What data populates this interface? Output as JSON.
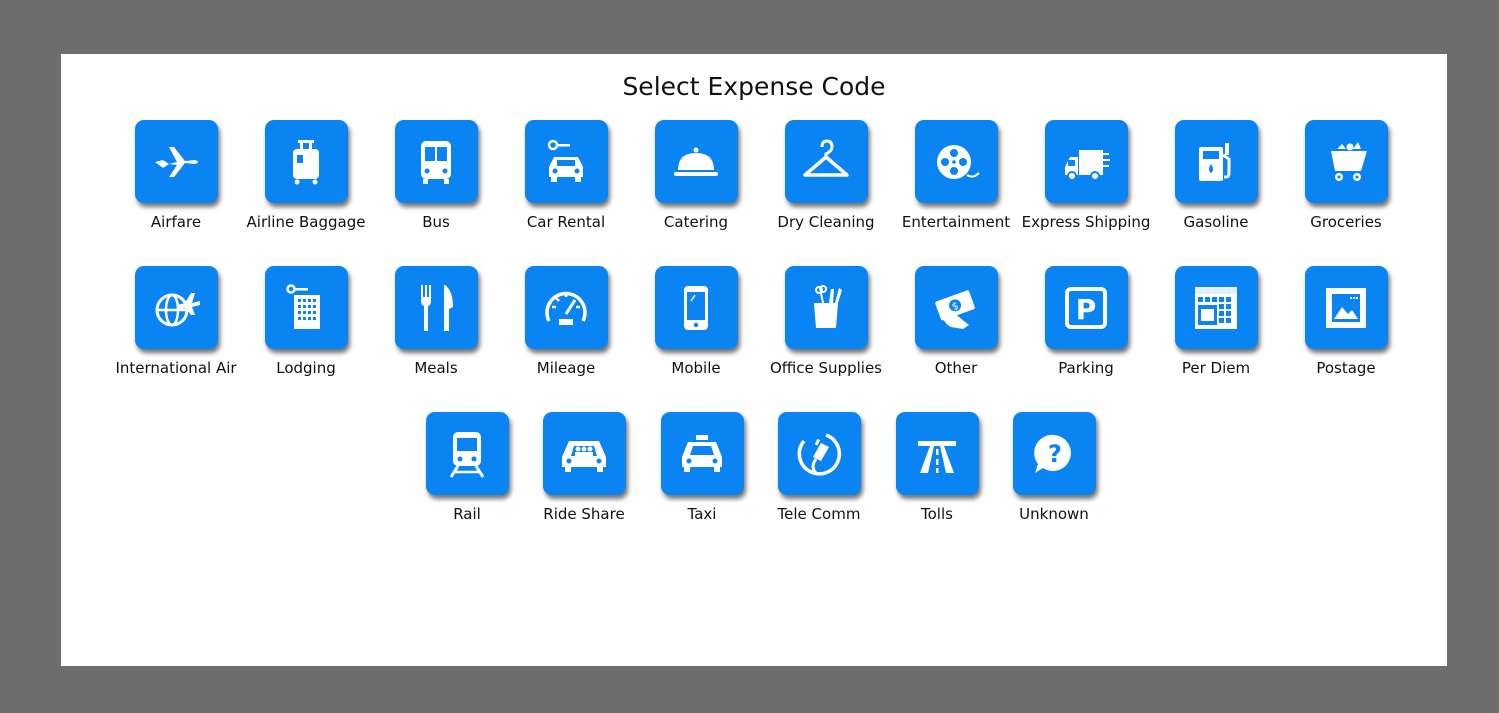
{
  "dialog": {
    "title": "Select Expense Code"
  },
  "codes": [
    {
      "label": "Airfare",
      "icon": "airplane-icon"
    },
    {
      "label": "Airline Baggage",
      "icon": "luggage-icon"
    },
    {
      "label": "Bus",
      "icon": "bus-icon"
    },
    {
      "label": "Car Rental",
      "icon": "car-key-icon"
    },
    {
      "label": "Catering",
      "icon": "cloche-icon"
    },
    {
      "label": "Dry Cleaning",
      "icon": "hanger-icon"
    },
    {
      "label": "Entertainment",
      "icon": "film-reel-icon"
    },
    {
      "label": "Express Shipping",
      "icon": "delivery-truck-icon"
    },
    {
      "label": "Gasoline",
      "icon": "fuel-pump-icon"
    },
    {
      "label": "Groceries",
      "icon": "shopping-cart-icon"
    },
    {
      "label": "International Air",
      "icon": "globe-airplane-icon"
    },
    {
      "label": "Lodging",
      "icon": "hotel-key-icon"
    },
    {
      "label": "Meals",
      "icon": "fork-knife-icon"
    },
    {
      "label": "Mileage",
      "icon": "speedometer-icon"
    },
    {
      "label": "Mobile",
      "icon": "smartphone-icon"
    },
    {
      "label": "Office Supplies",
      "icon": "pencil-cup-icon"
    },
    {
      "label": "Other",
      "icon": "money-hand-icon"
    },
    {
      "label": "Parking",
      "icon": "parking-sign-icon"
    },
    {
      "label": "Per Diem",
      "icon": "calendar-icon"
    },
    {
      "label": "Postage",
      "icon": "postage-stamp-icon"
    },
    {
      "label": "Rail",
      "icon": "train-icon"
    },
    {
      "label": "Ride Share",
      "icon": "carpool-icon"
    },
    {
      "label": "Taxi",
      "icon": "taxi-icon"
    },
    {
      "label": "Tele Comm",
      "icon": "phone-cable-icon"
    },
    {
      "label": "Tolls",
      "icon": "highway-icon"
    },
    {
      "label": "Unknown",
      "icon": "question-bubble-icon"
    }
  ],
  "colors": {
    "tile": "#0a84f2",
    "frame": "#6d6d6d",
    "dialog": "#ffffff"
  }
}
